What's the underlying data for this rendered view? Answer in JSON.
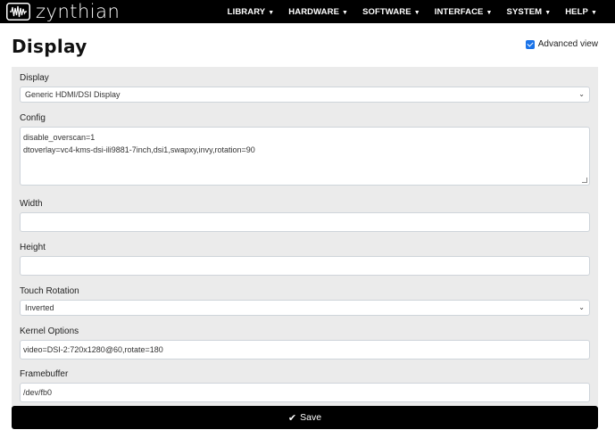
{
  "brand": {
    "name": "zynthian"
  },
  "nav": {
    "items": [
      {
        "label": "LIBRARY",
        "caret": "▼"
      },
      {
        "label": "HARDWARE",
        "caret": "▼"
      },
      {
        "label": "SOFTWARE",
        "caret": "▼"
      },
      {
        "label": "INTERFACE",
        "caret": "▼"
      },
      {
        "label": "SYSTEM",
        "caret": "▼"
      },
      {
        "label": "HELP",
        "caret": "▼"
      }
    ]
  },
  "page": {
    "title": "Display",
    "advanced_view_label": "Advanced view",
    "advanced_view_checked": true
  },
  "form": {
    "display": {
      "label": "Display",
      "value": "Generic HDMI/DSI Display"
    },
    "config": {
      "label": "Config",
      "lines": [
        "disable_overscan=1",
        "dtoverlay=vc4-kms-dsi-ili9881-7inch,dsi1,swapxy,invy,rotation=90"
      ]
    },
    "width": {
      "label": "Width",
      "value": ""
    },
    "height": {
      "label": "Height",
      "value": ""
    },
    "touch_rotation": {
      "label": "Touch Rotation",
      "value": "Inverted"
    },
    "kernel_options": {
      "label": "Kernel Options",
      "value": "video=DSI-2:720x1280@60,rotate=180"
    },
    "framebuffer": {
      "label": "Framebuffer",
      "value": "/dev/fb0"
    }
  },
  "save_button": {
    "label": "Save"
  },
  "colors": {
    "navbar": "#000000",
    "panel": "#ebebeb",
    "checkbox": "#1a73e8",
    "save_button": "#000000"
  }
}
